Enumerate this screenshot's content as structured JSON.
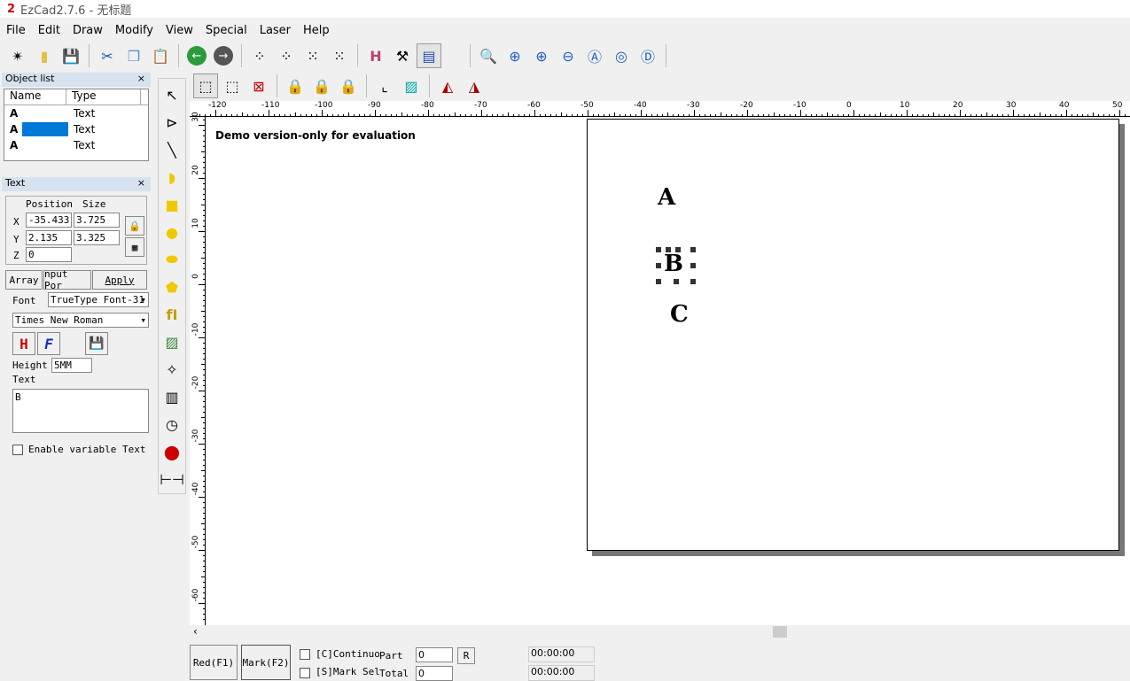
{
  "window": {
    "title": "EzCad2.7.6 - 无标题",
    "logo_text": "EZCAD"
  },
  "menu": [
    "File",
    "Edit",
    "Draw",
    "Modify",
    "View",
    "Special",
    "Laser",
    "Help"
  ],
  "object_list": {
    "title": "Object list",
    "columns": [
      "Name",
      "Type"
    ],
    "rows": [
      {
        "name": "A",
        "type": "Text",
        "selected": false
      },
      {
        "name": "A",
        "type": "Text",
        "selected": true
      },
      {
        "name": "A",
        "type": "Text",
        "selected": false
      }
    ]
  },
  "text_panel": {
    "title": "Text",
    "position_label": "Position",
    "size_label": "Size",
    "x_label": "X",
    "y_label": "Y",
    "z_label": "Z",
    "x": "-35.433",
    "y": "2.135",
    "z": "0",
    "size_x": "3.725",
    "size_y": "3.325",
    "array_label": "Array",
    "input_port_label": "nput Por",
    "apply_label": "Apply",
    "font_label": "Font",
    "font_type": "TrueType Font-31",
    "font_name": "Times New Roman",
    "height_label": "Height",
    "height": "5MM",
    "text_label": "Text",
    "text": "B",
    "enable_variable_label": "Enable variable Text"
  },
  "canvas": {
    "watermark": "Demo version-only for evaluation",
    "objects": [
      "A",
      "B",
      "C"
    ],
    "ruler_x": {
      "min": -120,
      "max": 50,
      "step": 10
    },
    "ruler_y": {
      "min": -60,
      "max": 30,
      "step": 10
    }
  },
  "bottom": {
    "red_label": "Red(F1)",
    "mark_label": "Mark(F2)",
    "continuous_label": "[C]Continuo",
    "mark_sel_label": "[S]Mark Sel",
    "part_label": "Part",
    "total_label": "Total",
    "part": "0",
    "total": "0",
    "r_label": "R",
    "time1": "00:00:00",
    "time2": "00:00:00"
  }
}
